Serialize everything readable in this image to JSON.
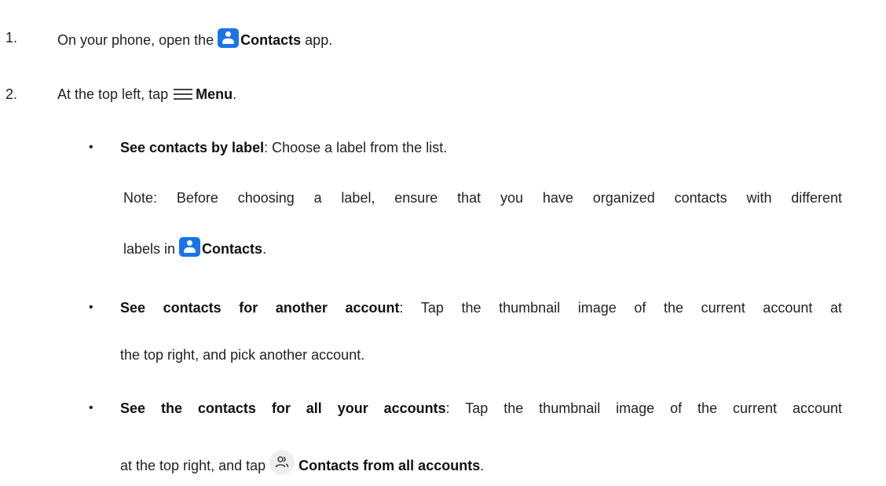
{
  "steps": [
    {
      "number": "1.",
      "before": "On your phone, open the ",
      "app_name": "Contacts",
      "after": " app.",
      "icon": "contacts-app-icon"
    },
    {
      "number": "2.",
      "before": "At the top left, tap ",
      "menu_label": "Menu",
      "after": ".",
      "icon": "hamburger-menu-icon"
    }
  ],
  "bullets": [
    {
      "title": "See contacts by label",
      "text": ": Choose a label from the list."
    },
    {
      "title": "See contacts for another account",
      "text": ": Tap the thumbnail image of the current account at",
      "continuation": "the top right, and pick another account."
    },
    {
      "title": "See the contacts for all your accounts",
      "text": ": Tap the thumbnail image of the current account",
      "continuation_before": "at the top right, and tap ",
      "continuation_bold": "Contacts from all accounts",
      "continuation_after": ".",
      "icon": "all-accounts-icon"
    }
  ],
  "note": {
    "line1": "Note: Before choosing a label, ensure that you have organized contacts with different",
    "line2_before": "labels in ",
    "line2_bold": "Contacts",
    "line2_after": "."
  },
  "colors": {
    "contacts_icon": "#1a73e8",
    "text": "#222222"
  },
  "bullet_glyph": "•"
}
